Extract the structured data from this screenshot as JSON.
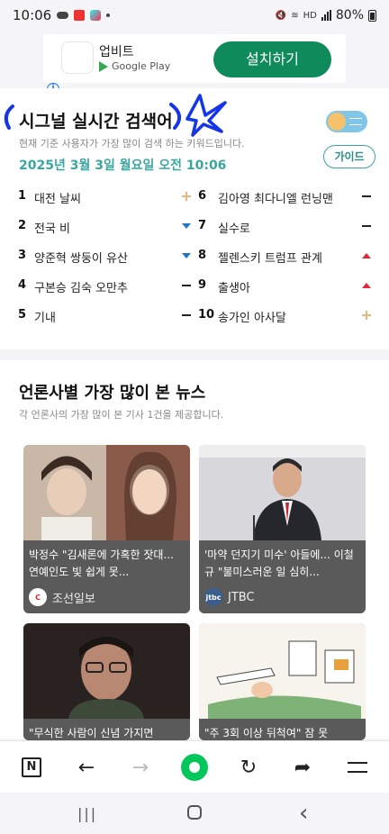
{
  "status_bar": {
    "time": "10:06",
    "network": "HD",
    "battery": "80%"
  },
  "ad": {
    "app_name": "업비트",
    "store": "Google Play",
    "install_label": "설치하기",
    "info_glyph": "i",
    "close_glyph": "✕"
  },
  "signal": {
    "title": "시그널 실시간 검색어",
    "subtitle": "현재 기준 사용자가 가장 많이 검색 하는 키워드입니다.",
    "datetime": "2025년 3월 3일 월요일 오전 10:06",
    "guide_label": "가이드",
    "rankings_left": [
      {
        "rank": "1",
        "keyword": "대전 날씨",
        "trend": "new"
      },
      {
        "rank": "2",
        "keyword": "전국 비",
        "trend": "down"
      },
      {
        "rank": "3",
        "keyword": "양준혁 쌍둥이 유산",
        "trend": "down"
      },
      {
        "rank": "4",
        "keyword": "구본승 김숙 오만추",
        "trend": "flat"
      },
      {
        "rank": "5",
        "keyword": "기내",
        "trend": "flat"
      }
    ],
    "rankings_right": [
      {
        "rank": "6",
        "keyword": "김아영 최다니엘 런닝맨",
        "trend": "flat"
      },
      {
        "rank": "7",
        "keyword": "실수로",
        "trend": "flat"
      },
      {
        "rank": "8",
        "keyword": "젤렌스키 트럼프 관계",
        "trend": "up"
      },
      {
        "rank": "9",
        "keyword": "출생아",
        "trend": "up"
      },
      {
        "rank": "10",
        "keyword": "송가인 아사달",
        "trend": "new"
      }
    ]
  },
  "news": {
    "title": "언론사별 가장 많이 본 뉴스",
    "subtitle": "각 언론사의 가장 많이 본 기사 1건을 제공합니다.",
    "articles": [
      {
        "headline": "박정수 \"김새론에 가혹한 잣대... 연예인도 빛 쉽게 못...",
        "source": "조선일보"
      },
      {
        "headline": "'마약 던지기 미수' 아들에... 이철규 \"불미스러운 일 심히...",
        "source": "JTBC"
      },
      {
        "headline": "\"무식한 사람이 신념 가지면",
        "source": ""
      },
      {
        "headline": "\"주 3회 이상 뒤척여\" 잠 못",
        "source": ""
      }
    ]
  },
  "toolbar": {
    "n_label": "N",
    "back_glyph": "←",
    "forward_glyph": "→",
    "refresh_glyph": "↻",
    "share_glyph": "➦"
  },
  "navbar": {
    "recent_glyph": "|||",
    "back_glyph": "‹"
  }
}
